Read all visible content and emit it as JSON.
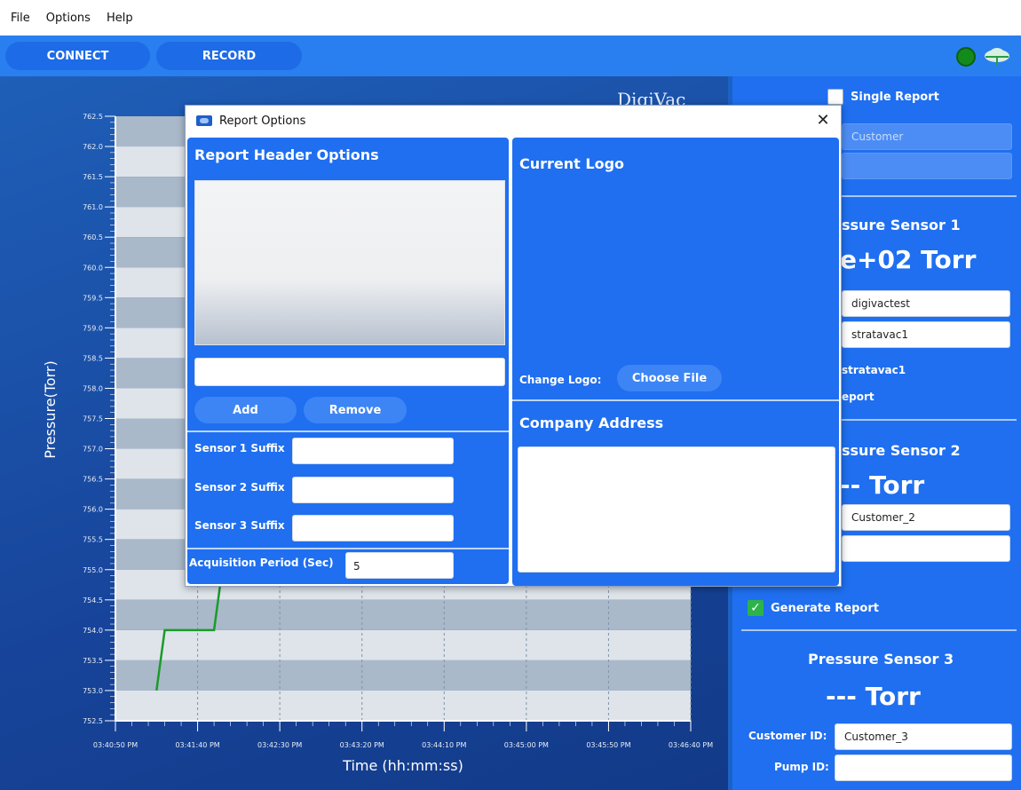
{
  "menu": {
    "file": "File",
    "options": "Options",
    "help": "Help"
  },
  "toolbar": {
    "connect": "CONNECT",
    "record": "RECORD",
    "status_color": "#138a1c"
  },
  "brand": "DigiVac",
  "chart_data": {
    "type": "line",
    "title": "",
    "xlabel": "Time (hh:mm:ss)",
    "ylabel": "Pressure(Torr)",
    "ylim": [
      752.5,
      762.5
    ],
    "yticks": [
      "762.5",
      "762.0",
      "761.5",
      "761.0",
      "760.5",
      "760.0",
      "759.5",
      "759.0",
      "758.5",
      "758.0",
      "757.5",
      "757.0",
      "756.5",
      "756.0",
      "755.5",
      "755.0",
      "754.5",
      "754.0",
      "753.5",
      "753.0",
      "752.5"
    ],
    "xticks": [
      "03:40:50 PM",
      "03:41:40 PM",
      "03:42:30 PM",
      "03:43:20 PM",
      "03:44:10 PM",
      "03:45:00 PM",
      "03:45:50 PM",
      "03:46:40 PM"
    ],
    "series": [
      {
        "color": "#1a9b2a",
        "points": [
          [
            0.5,
            753.0
          ],
          [
            0.6,
            754.0
          ],
          [
            1.2,
            754.0
          ],
          [
            1.3,
            755.0
          ]
        ]
      }
    ],
    "grid": true
  },
  "sidepanel": {
    "single_report": "Single Report",
    "customer_placeholder": "Customer",
    "sensor1": {
      "title": "ssure Sensor 1",
      "reading": "e+02 Torr",
      "field1": "digivactest",
      "field2": "stratavac1",
      "label1": "stratavac1",
      "label2": "eport"
    },
    "sensor2": {
      "title": "ssure Sensor 2",
      "reading": "-- Torr",
      "customer": "Customer_2",
      "generate_report": "Generate Report"
    },
    "sensor3": {
      "title": "Pressure Sensor 3",
      "reading": "--- Torr",
      "customer_id_label": "Customer ID:",
      "customer_id": "Customer_3",
      "pump_id_label": "Pump ID:",
      "pump_id": ""
    }
  },
  "dialog": {
    "title": "Report Options",
    "report_header_options": "Report Header Options",
    "header_input": "",
    "add": "Add",
    "remove": "Remove",
    "sensor1_suffix_label": "Sensor 1 Suffix",
    "sensor2_suffix_label": "Sensor 2 Suffix",
    "sensor3_suffix_label": "Sensor 3 Suffix",
    "sensor1_suffix": "",
    "sensor2_suffix": "",
    "sensor3_suffix": "",
    "acquisition_label": "Acquisition Period (Sec)",
    "acquisition_value": "5",
    "current_logo": "Current Logo",
    "change_logo_label": "Change Logo:",
    "choose_file": "Choose File",
    "company_address": "Company Address"
  }
}
